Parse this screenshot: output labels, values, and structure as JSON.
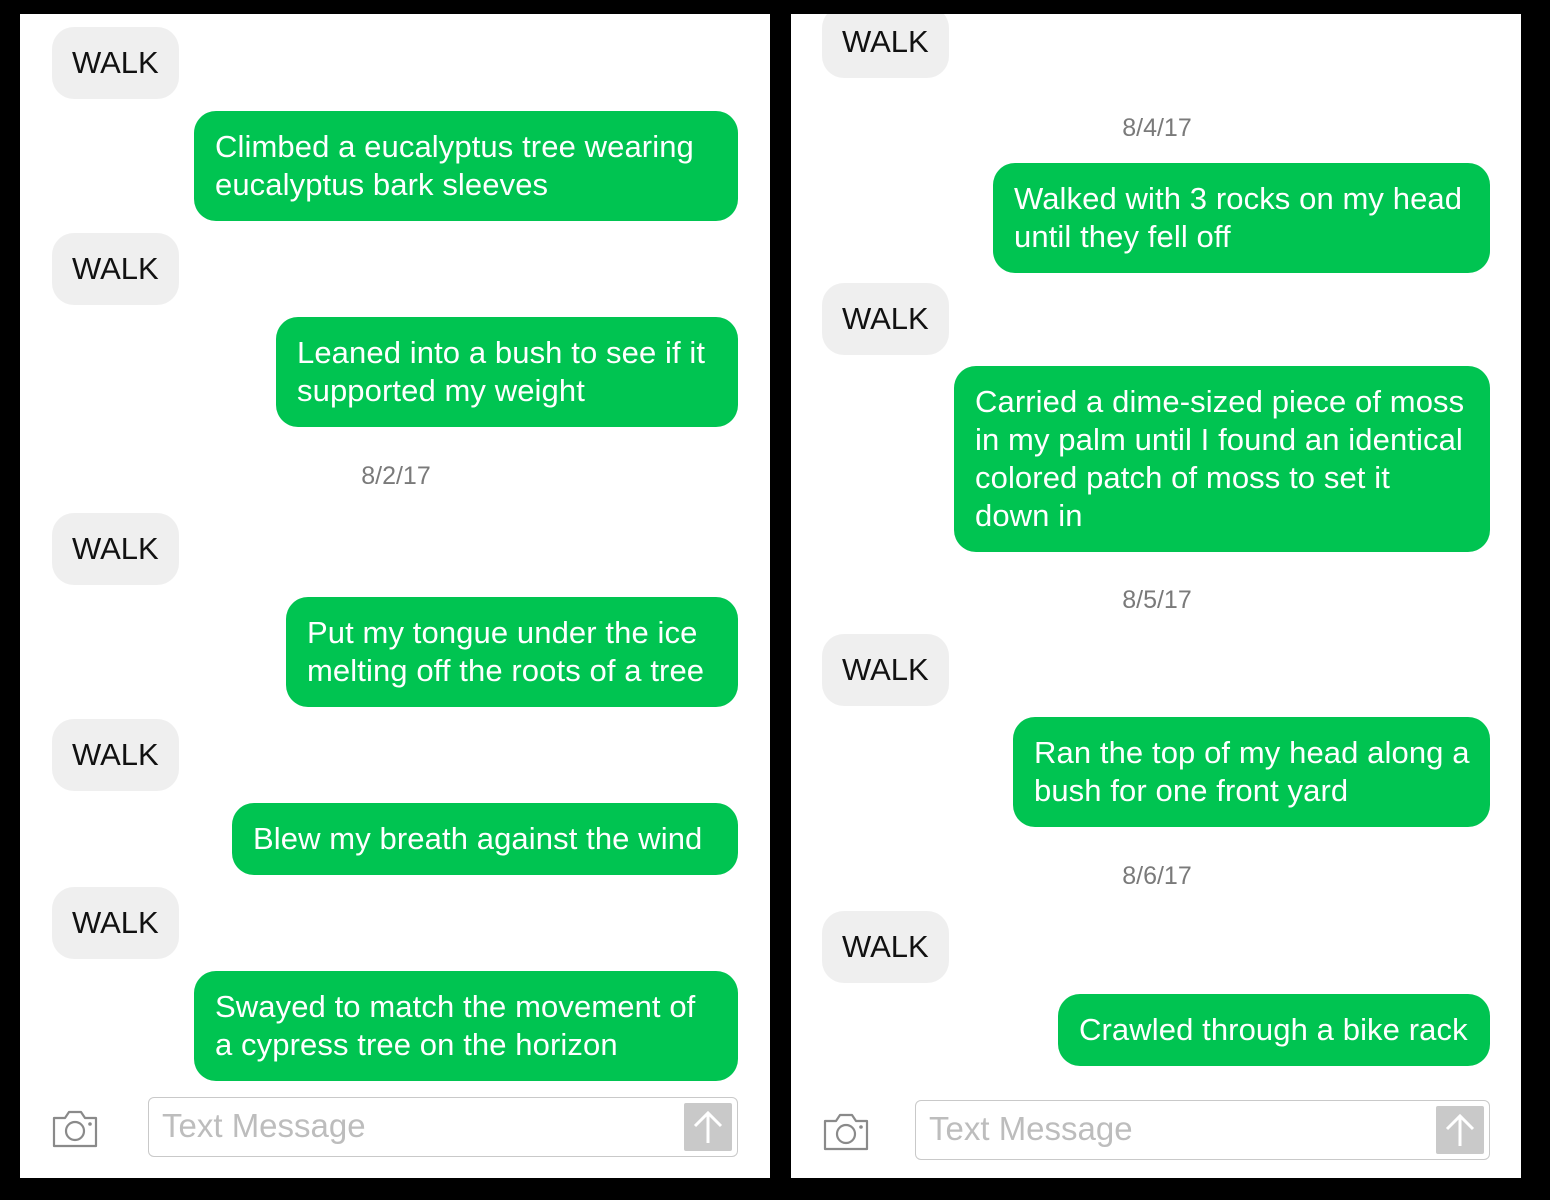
{
  "left": {
    "messages": [
      {
        "from": "them",
        "text": "WALK"
      },
      {
        "from": "me",
        "text": "Climbed a eucalyptus tree wearing eucalyptus bark sleeves"
      },
      {
        "from": "them",
        "text": "WALK"
      },
      {
        "from": "me",
        "text": "Leaned into a bush to see if it supported my weight"
      },
      {
        "date": "8/2/17"
      },
      {
        "from": "them",
        "text": "WALK"
      },
      {
        "from": "me",
        "text": "Put my tongue under the ice melting off the roots of a tree"
      },
      {
        "from": "them",
        "text": "WALK"
      },
      {
        "from": "me",
        "text": "Blew my breath against the wind"
      },
      {
        "from": "them",
        "text": "WALK"
      },
      {
        "from": "me",
        "text": "Swayed to match the movement of a cypress tree on the horizon"
      }
    ],
    "composer": {
      "placeholder": "Text Message"
    }
  },
  "right": {
    "messages": [
      {
        "from": "them",
        "text": "WALK"
      },
      {
        "date": "8/4/17"
      },
      {
        "from": "me",
        "text": "Walked with 3 rocks on my head until they fell off"
      },
      {
        "from": "them",
        "text": "WALK"
      },
      {
        "from": "me",
        "text": "Carried a dime-sized piece of moss in my palm until I found an identical colored patch of moss to set it down in"
      },
      {
        "date": "8/5/17"
      },
      {
        "from": "them",
        "text": "WALK"
      },
      {
        "from": "me",
        "text": "Ran the top of my head along a bush for one front yard"
      },
      {
        "date": "8/6/17"
      },
      {
        "from": "them",
        "text": "WALK"
      },
      {
        "from": "me",
        "text": "Crawled through a bike rack"
      }
    ],
    "composer": {
      "placeholder": "Text Message"
    }
  },
  "icons": {
    "camera": "camera-icon",
    "send": "arrow-up-icon"
  },
  "colors": {
    "outgoing_bubble": "#00c451",
    "incoming_bubble": "#efefef",
    "frame": "#000000"
  }
}
